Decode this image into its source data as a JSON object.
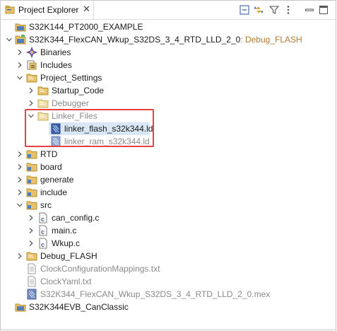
{
  "view": {
    "title": "Project Explorer",
    "close_glyph": "✕",
    "toolbar": [
      {
        "name": "collapse-all-icon"
      },
      {
        "name": "link-with-editor-icon"
      },
      {
        "name": "filter-icon"
      },
      {
        "name": "view-menu-icon"
      },
      {
        "name": "minimize-icon"
      },
      {
        "name": "maximize-icon"
      }
    ]
  },
  "tree": [
    {
      "label": "S32K144_PT2000_EXAMPLE",
      "icon": "project-closed-icon",
      "expanded": null
    },
    {
      "label": "S32K344_FlexCAN_Wkup_S32DS_3_4_RTD_LLD_2_0",
      "suffix": ": Debug_FLASH",
      "icon": "project-open-icon",
      "expanded": true
    },
    {
      "label": "Binaries",
      "icon": "binaries-icon",
      "expanded": false
    },
    {
      "label": "Includes",
      "icon": "includes-icon",
      "expanded": false
    },
    {
      "label": "Project_Settings",
      "icon": "folder-icon",
      "expanded": true
    },
    {
      "label": "Startup_Code",
      "icon": "folder-icon",
      "expanded": false
    },
    {
      "label": "Debugger",
      "icon": "folder-icon",
      "expanded": false,
      "dim": true
    },
    {
      "label": "Linker_Files",
      "icon": "folder-icon",
      "expanded": true,
      "dim": true
    },
    {
      "label": "linker_flash_s32k344.ld",
      "icon": "linker-file-icon",
      "expanded": null,
      "selected": true
    },
    {
      "label": "linker_ram_s32k344.ld",
      "icon": "linker-file-icon",
      "expanded": null,
      "dim": true
    },
    {
      "label": "RTD",
      "icon": "source-folder-icon",
      "expanded": false
    },
    {
      "label": "board",
      "icon": "source-folder-icon",
      "expanded": false
    },
    {
      "label": "generate",
      "icon": "source-folder-icon",
      "expanded": false
    },
    {
      "label": "include",
      "icon": "source-folder-icon",
      "expanded": false
    },
    {
      "label": "src",
      "icon": "source-folder-icon",
      "expanded": true
    },
    {
      "label": "can_config.c",
      "icon": "c-file-icon",
      "expanded": false
    },
    {
      "label": "main.c",
      "icon": "c-file-icon",
      "expanded": false
    },
    {
      "label": "Wkup.c",
      "icon": "c-file-icon",
      "expanded": false
    },
    {
      "label": "Debug_FLASH",
      "icon": "folder-icon",
      "expanded": false
    },
    {
      "label": "ClockConfigurationMappings.txt",
      "icon": "text-file-icon",
      "expanded": null,
      "dim": true
    },
    {
      "label": "ClockYaml.txt",
      "icon": "text-file-icon",
      "expanded": null,
      "dim": true
    },
    {
      "label": "S32K344_FlexCAN_Wkup_S32DS_3_4_RTD_LLD_2_0.mex",
      "icon": "mex-file-icon",
      "expanded": null,
      "dim": true
    },
    {
      "label": "S32K344EVB_CanClassic",
      "icon": "project-closed-icon",
      "expanded": null
    }
  ],
  "colors": {
    "highlight_border": "#e8413f",
    "selection": "#d8e6f6",
    "suffix": "#b07a32",
    "folder": "#e8c26a",
    "dim_text": "#8a8a8a"
  }
}
